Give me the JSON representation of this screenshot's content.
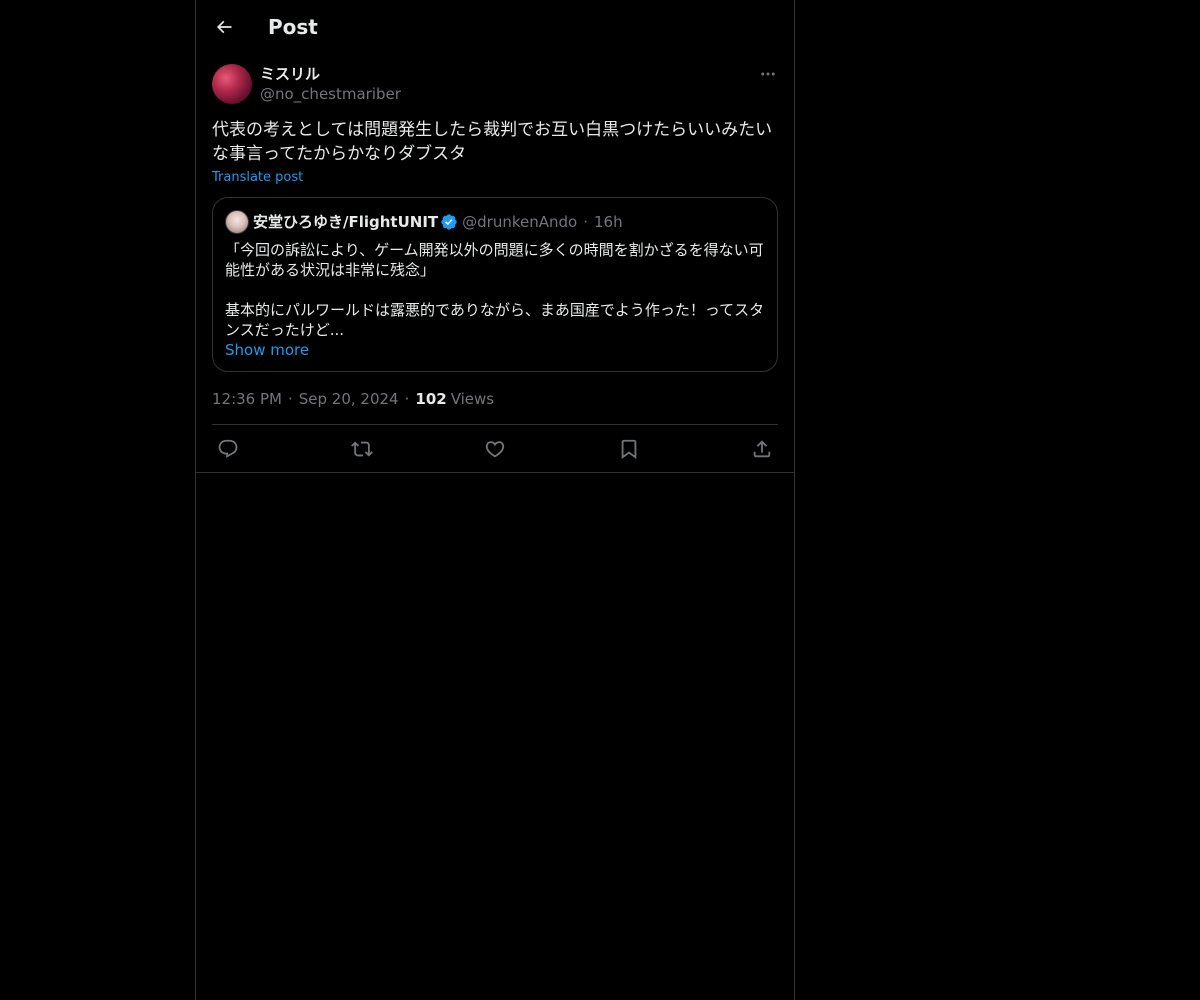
{
  "header": {
    "title": "Post"
  },
  "post": {
    "display_name": "ミスリル",
    "handle": "@no_chestmariber",
    "text": "代表の考えとしては問題発生したら裁判でお互い白黒つけたらいいみたいな事言ってたからかなりダブスタ",
    "translate_label": "Translate post",
    "time": "12:36 PM",
    "date": "Sep 20, 2024",
    "views_count": "102",
    "views_label": "Views"
  },
  "quote": {
    "display_name": "安堂ひろゆき/FlightUNIT",
    "handle": "@drunkenAndo",
    "time": "16h",
    "text": "「今回の訴訟により、ゲーム開発以外の問題に多くの時間を割かざるを得ない可能性がある状況は非常に残念」\n\n基本的にパルワールドは露悪的でありながら、まあ国産でよう作った！ってスタンスだったけど...",
    "show_more_label": "Show more"
  },
  "colors": {
    "background": "#000000",
    "accent": "#1d9bf0",
    "border": "#2f3336",
    "muted": "#71767b",
    "verified": "#1d9bf0"
  },
  "icons": [
    "back-arrow-icon",
    "more-icon",
    "verified-icon",
    "reply-icon",
    "repost-icon",
    "like-icon",
    "bookmark-icon",
    "share-icon"
  ]
}
